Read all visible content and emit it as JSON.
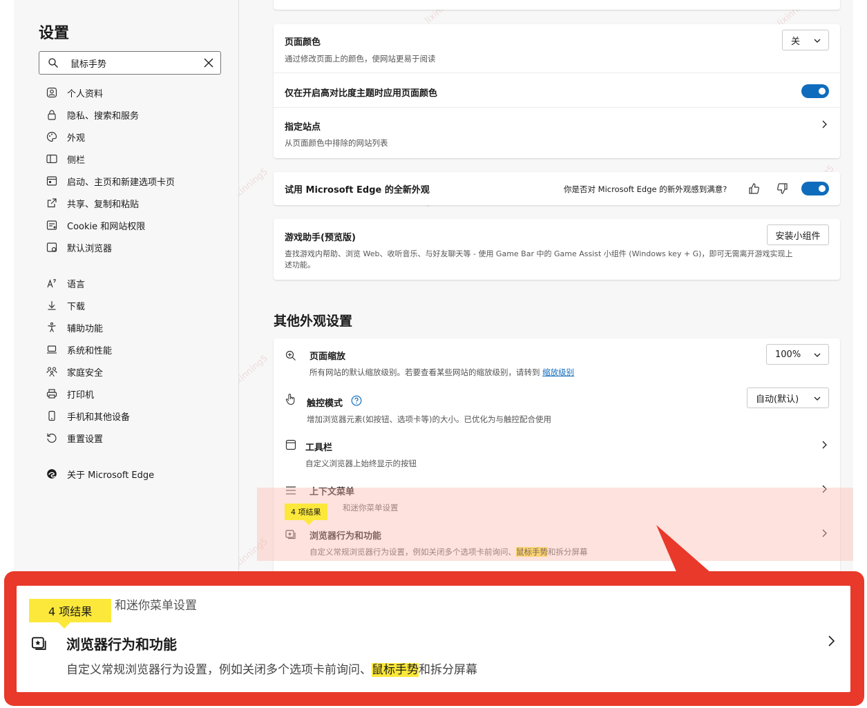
{
  "sidebar": {
    "title": "设置",
    "search": {
      "value": "鼠标手势"
    },
    "items": [
      {
        "label": "个人资料",
        "icon": "profile-icon"
      },
      {
        "label": "隐私、搜索和服务",
        "icon": "lock-icon"
      },
      {
        "label": "外观",
        "icon": "palette-icon"
      },
      {
        "label": "侧栏",
        "icon": "sidebar-icon"
      },
      {
        "label": "启动、主页和新建选项卡页",
        "icon": "home-tab-icon"
      },
      {
        "label": "共享、复制和粘贴",
        "icon": "share-icon"
      },
      {
        "label": "Cookie 和网站权限",
        "icon": "cookie-icon"
      },
      {
        "label": "默认浏览器",
        "icon": "browser-icon"
      },
      {
        "label": "语言",
        "icon": "language-icon"
      },
      {
        "label": "下载",
        "icon": "download-icon"
      },
      {
        "label": "辅助功能",
        "icon": "accessibility-icon"
      },
      {
        "label": "系统和性能",
        "icon": "system-icon"
      },
      {
        "label": "家庭安全",
        "icon": "family-icon"
      },
      {
        "label": "打印机",
        "icon": "printer-icon"
      },
      {
        "label": "手机和其他设备",
        "icon": "phone-icon"
      },
      {
        "label": "重置设置",
        "icon": "reset-icon"
      },
      {
        "label": "关于 Microsoft Edge",
        "icon": "edge-logo-icon"
      }
    ]
  },
  "page_color": {
    "title": "页面颜色",
    "desc": "通过修改页面上的颜色，使网站更易于阅读",
    "dropdown_value": "关",
    "high_contrast_title": "仅在开启高对比度主题时应用页面颜色",
    "high_contrast_on": true,
    "sites_title": "指定站点",
    "sites_desc": "从页面颜色中排除的网站列表"
  },
  "new_look": {
    "title": "试用 Microsoft Edge 的全新外观",
    "question": "你是否对 Microsoft Edge 的新外观感到满意?",
    "enabled": true
  },
  "game_assist": {
    "title": "游戏助手(预览版)",
    "desc_line1": "查找游戏内帮助、浏览 Web、收听音乐、与好友聊天等 - 使用 Game Bar 中的 Game Assist 小组件 (Windows key + G)，即可无需离开游戏实现上",
    "desc_line2": "述功能。",
    "button": "安装小组件"
  },
  "other_appearance": {
    "heading": "其他外观设置",
    "zoom_title": "页面缩放",
    "zoom_desc": "所有网站的默认缩放级别。若要查看某些网站的缩放级别，请转到",
    "zoom_link": "缩放级别",
    "zoom_value": "100%",
    "touch_title": "触控模式",
    "touch_desc": "增加浏览器元素(如按钮、选项卡等)的大小。已优化为与触控配合使用",
    "touch_value": "自动(默认)",
    "toolbar_title": "工具栏",
    "toolbar_desc": "自定义浏览器上始终显示的按钮",
    "context_title": "上下文菜单",
    "context_desc": "和迷你菜单设置",
    "behavior_title": "浏览器行为和功能",
    "behavior_desc_pre": "自定义常规浏览器行为设置，例如关闭多个选项卡前询问、",
    "behavior_desc_mark": "鼠标手势",
    "behavior_desc_post": "和拆分屏幕",
    "results_badge": "4 项结果"
  },
  "callout": {
    "sub": "和迷你菜单设置",
    "badge": "4 项结果",
    "title": "浏览器行为和功能",
    "desc_pre": "自定义常规浏览器行为设置，例如关闭多个选项卡前询问、",
    "desc_mark": "鼠标手势",
    "desc_post": "和拆分屏幕"
  },
  "watermark": "lixinning5",
  "colors": {
    "accent": "#0f6cbd",
    "highlight": "#fce83a",
    "callout": "#e8392a"
  }
}
